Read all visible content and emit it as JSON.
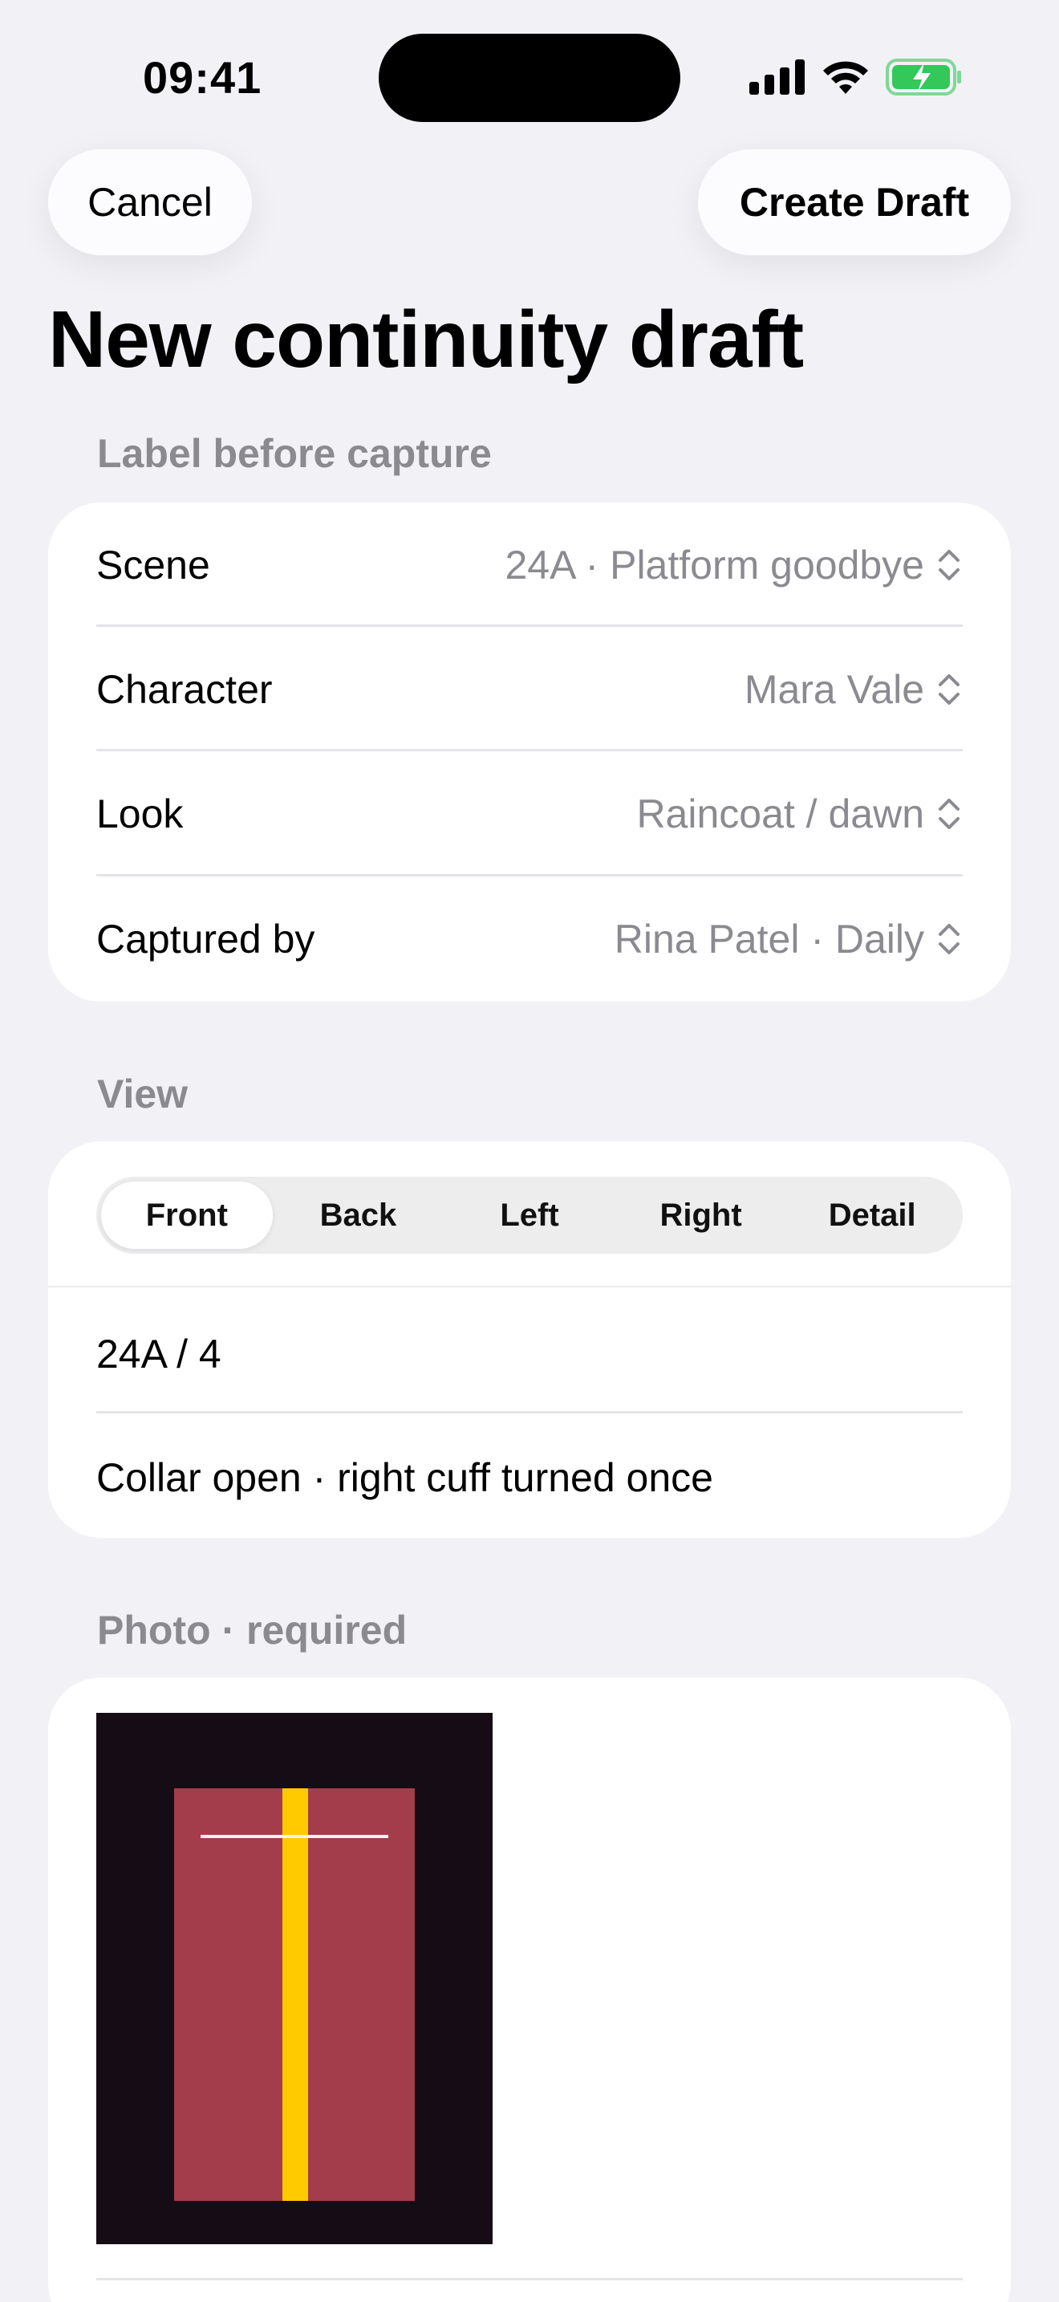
{
  "status_bar": {
    "time": "09:41",
    "battery_color": "#34c759"
  },
  "nav": {
    "cancel_label": "Cancel",
    "create_label": "Create Draft"
  },
  "page": {
    "title": "New continuity draft"
  },
  "label_section": {
    "header": "Label before capture",
    "rows": [
      {
        "label": "Scene",
        "value": "24A · Platform goodbye"
      },
      {
        "label": "Character",
        "value": "Mara Vale"
      },
      {
        "label": "Look",
        "value": "Raincoat / dawn"
      },
      {
        "label": "Captured by",
        "value": "Rina Patel · Daily"
      }
    ]
  },
  "view_section": {
    "header": "View",
    "segments": [
      "Front",
      "Back",
      "Left",
      "Right",
      "Detail"
    ],
    "selected": "Front",
    "shot_field": "24A / 4",
    "note_field": "Collar open · right cuff turned once"
  },
  "photo_section": {
    "header": "Photo · required",
    "thumbnail_colors": {
      "background": "#160c16",
      "garment": "#a33d4b",
      "stripe": "#ffcb00"
    }
  }
}
